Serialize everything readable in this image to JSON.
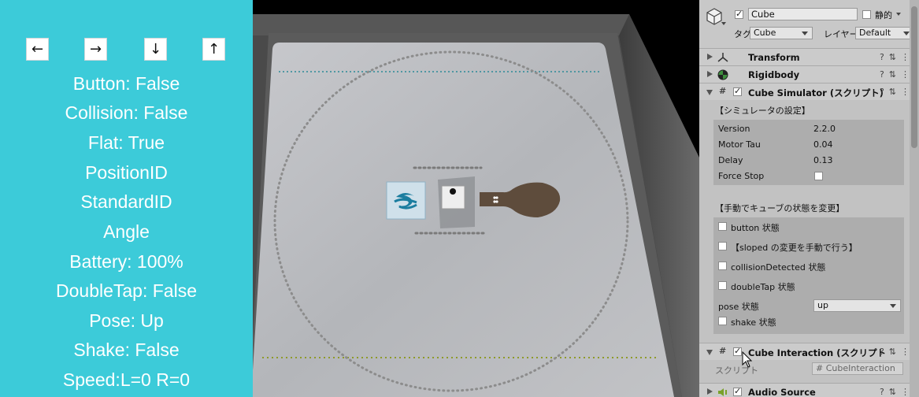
{
  "status_panel": {
    "arrows": {
      "left": "←",
      "right": "→",
      "down": "↓",
      "up": "↑"
    },
    "lines": [
      "Button: False",
      "Collision: False",
      "Flat: True",
      "PositionID",
      "StandardID",
      "Angle",
      "Battery: 100%",
      "DoubleTap: False",
      "Pose: Up",
      "Shake: False",
      "Speed:L=0 R=0"
    ]
  },
  "inspector": {
    "object": {
      "name": "Cube",
      "static_label": "静的",
      "tag_label": "タグ",
      "tag_value": "Cube",
      "layer_label": "レイヤー",
      "layer_value": "Default"
    },
    "components": {
      "transform": "Transform",
      "rigidbody": "Rigidbody",
      "cube_simulator": "Cube Simulator (スクリプト)",
      "cube_interaction": "Cube Interaction (スクリプト",
      "audio_source": "Audio Source"
    },
    "simulator_settings": {
      "section_label": "【シミュレータの設定】",
      "version_label": "Version",
      "version_value": "2.2.0",
      "motor_tau_label": "Motor Tau",
      "motor_tau_value": "0.04",
      "delay_label": "Delay",
      "delay_value": "0.13",
      "force_stop_label": "Force Stop"
    },
    "manual_state": {
      "section_label": "【手動でキューブの状態を変更】",
      "button_label": "button 状態",
      "sloped_label": "【sloped の変更を手動で行う】",
      "collision_label": "collisionDetected 状態",
      "doubletap_label": "doubleTap 状態",
      "pose_label": "pose 状態",
      "pose_value": "up",
      "shake_label": "shake 状態"
    },
    "script_row": {
      "label": "スクリプト",
      "value": "CubeInteraction"
    }
  },
  "colors": {
    "panel_bg": "#3ccbd9",
    "mat": "#b9bbbf",
    "inspector_bg": "#c2c2c2"
  }
}
